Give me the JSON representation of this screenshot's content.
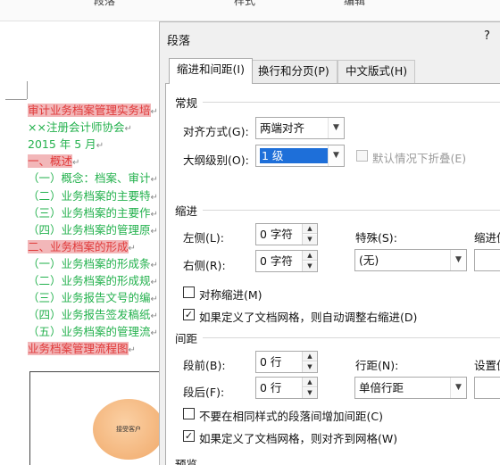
{
  "ribbon": {
    "items": [
      "段落",
      "样式",
      "编辑"
    ]
  },
  "document": {
    "lines": [
      {
        "text": "审计业务档案管理实务培",
        "color": "red",
        "highlight": true
      },
      {
        "text": "××注册会计师协会",
        "color": "green",
        "highlight": false
      },
      {
        "text": "2015 年 5 月",
        "color": "green",
        "highlight": false
      },
      {
        "text": "一、概述",
        "color": "red",
        "highlight": true
      },
      {
        "text": "（一）概念：档案、审计",
        "color": "green",
        "highlight": false
      },
      {
        "text": "（二）业务档案的主要特",
        "color": "green",
        "highlight": false
      },
      {
        "text": "（三）业务档案的主要作",
        "color": "green",
        "highlight": false
      },
      {
        "text": "（四）业务档案的管理原",
        "color": "green",
        "highlight": false
      },
      {
        "text": "二、业务档案的形成",
        "color": "red",
        "highlight": true
      },
      {
        "text": "（一）业务档案的形成条",
        "color": "green",
        "highlight": false
      },
      {
        "text": "（二）业务档案的形成规",
        "color": "green",
        "highlight": false
      },
      {
        "text": "（三）业务报告文号的编",
        "color": "green",
        "highlight": false
      },
      {
        "text": "（四）业务报告签发稿纸",
        "color": "green",
        "highlight": false
      },
      {
        "text": "（五）业务档案的管理流",
        "color": "green",
        "highlight": false
      },
      {
        "text": "业务档案管理流程图",
        "color": "red",
        "highlight": true
      }
    ],
    "pilcrow": "↵",
    "flowchart": {
      "node_label": "接受客户"
    }
  },
  "dialog": {
    "title": "段落",
    "help": "?",
    "tabs": [
      {
        "label": "缩进和间距(I)",
        "active": true
      },
      {
        "label": "换行和分页(P)",
        "active": false
      },
      {
        "label": "中文版式(H)",
        "active": false
      }
    ],
    "general": {
      "heading": "常规",
      "alignment_label": "对齐方式(G):",
      "alignment_value": "两端对齐",
      "outline_label": "大纲级别(O):",
      "outline_value": "1 级",
      "collapse_label": "默认情况下折叠(E)"
    },
    "indent": {
      "heading": "缩进",
      "left_label": "左侧(L):",
      "left_value": "0 字符",
      "right_label": "右侧(R):",
      "right_value": "0 字符",
      "special_label": "特殊(S):",
      "special_value": "(无)",
      "by_label": "缩进值",
      "mirror_label": "对称缩进(M)",
      "mirror_checked": false,
      "auto_adjust_label": "如果定义了文档网格，则自动调整右缩进(D)",
      "auto_adjust_checked": true
    },
    "spacing": {
      "heading": "间距",
      "before_label": "段前(B):",
      "before_value": "0 行",
      "after_label": "段后(F):",
      "after_value": "0 行",
      "line_spacing_label": "行距(N):",
      "line_spacing_value": "单倍行距",
      "at_label": "设置值",
      "no_space_label": "不要在相同样式的段落间增加间距(C)",
      "no_space_checked": false,
      "snap_grid_label": "如果定义了文档网格，则对齐到网格(W)",
      "snap_grid_checked": true
    },
    "preview": {
      "heading": "预览"
    }
  }
}
